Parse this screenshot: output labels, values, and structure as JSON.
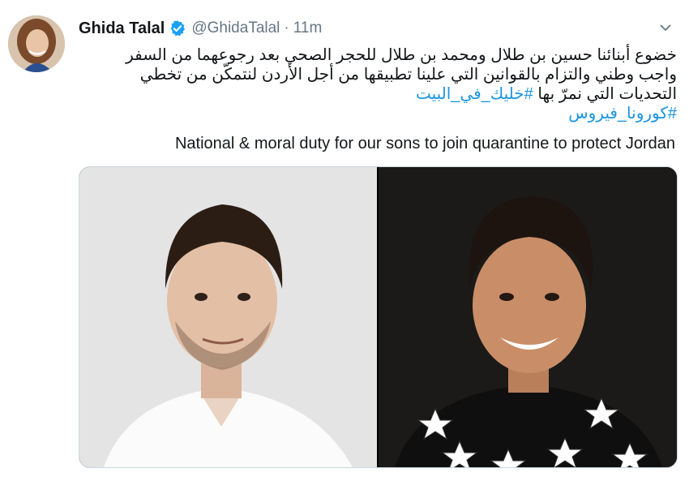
{
  "tweet": {
    "author_name": "Ghida Talal",
    "handle": "@GhidaTalal",
    "separator": "·",
    "timestamp": "11m",
    "arabic_lines": [
      "خضوع أبنائنا حسين بن طلال ومحمد بن طلال للحجر الصحي بعد رجوعهما من السفر",
      "واجب وطني والتزام بالقوانين التي علينا تطبيقها من أجل الأردن لنتمكّن من تخطي",
      "التحديات التي نمرّ بها"
    ],
    "hashtags": [
      "#خليك_في_البيت",
      "#كورونا_فيروس"
    ],
    "english_text": "National & moral duty for our sons to join quarantine to protect Jordan"
  },
  "icons": {
    "verified": "verified-badge-icon",
    "menu": "chevron-down-icon"
  },
  "colors": {
    "link": "#1b95e0",
    "secondary_text": "#657786",
    "verified": "#1da1f2"
  }
}
